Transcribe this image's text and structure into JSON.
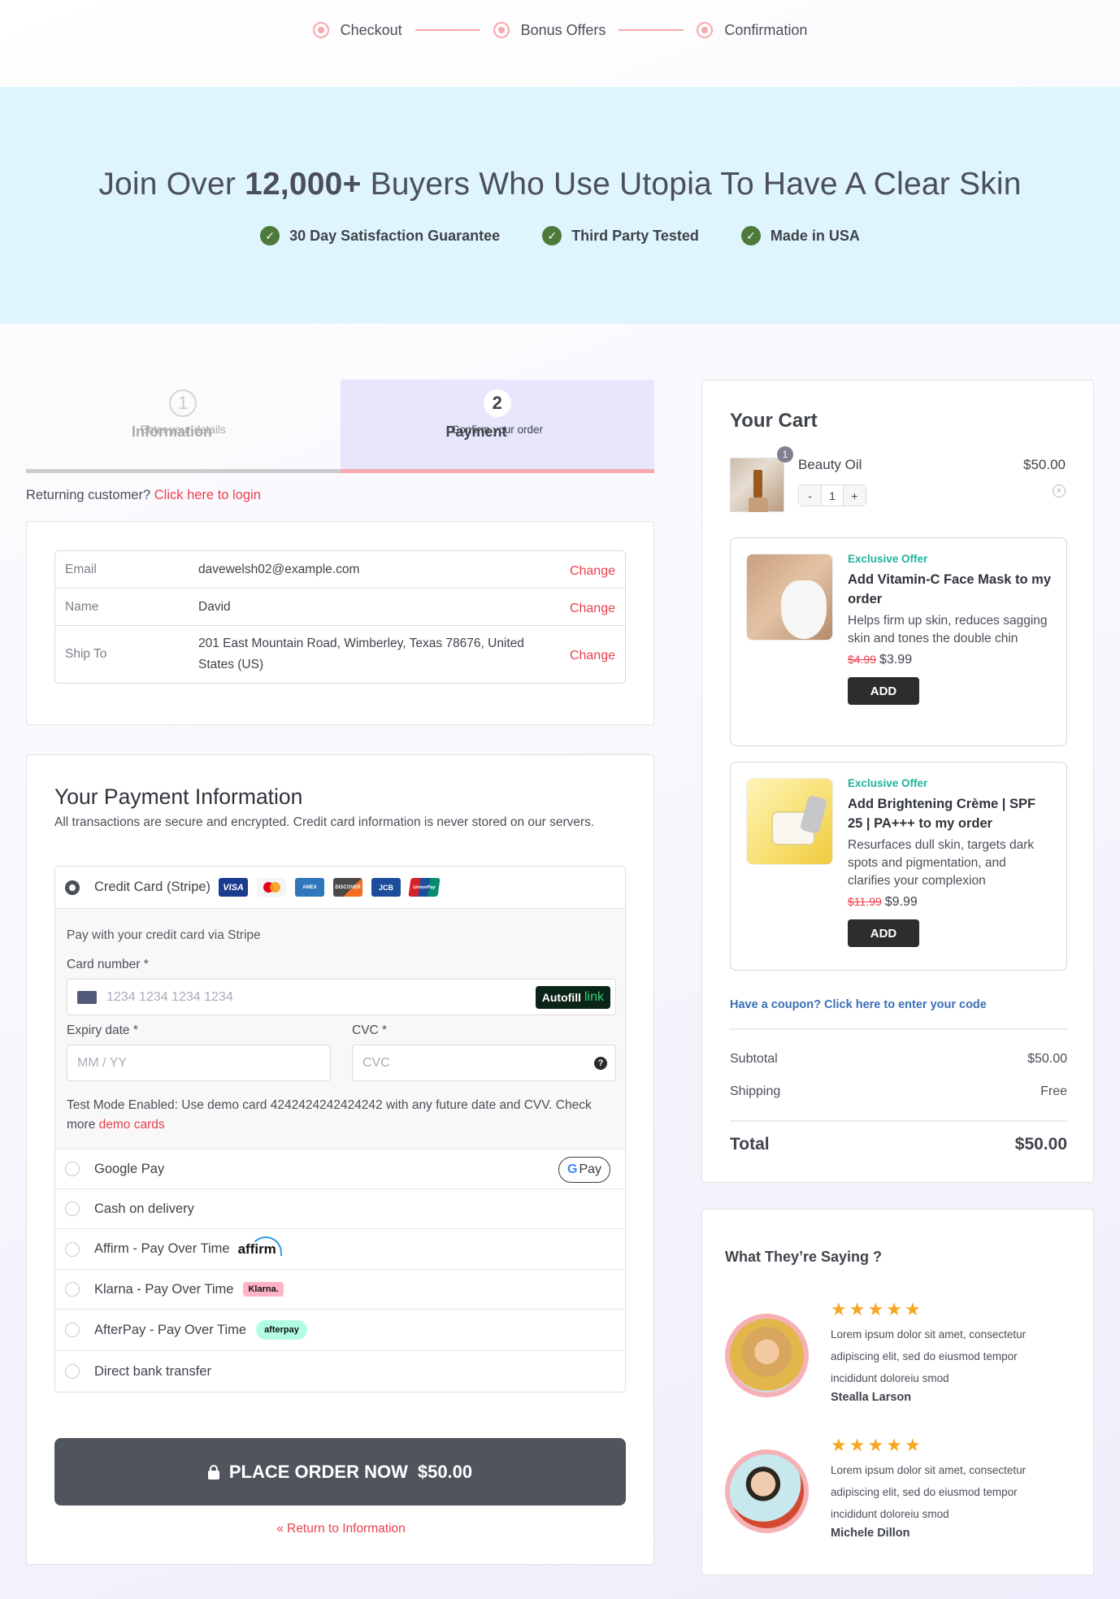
{
  "progress": {
    "steps": [
      "Checkout",
      "Bonus Offers",
      "Confirmation"
    ]
  },
  "hero": {
    "heading_pre": "Join Over ",
    "heading_bold": "12,000+",
    "heading_post": " Buyers Who Use Utopia To Have A Clear Skin",
    "badges": [
      "30 Day Satisfaction Guarantee",
      "Third Party Tested",
      "Made in USA"
    ]
  },
  "checkout_steps": [
    {
      "number": "1",
      "title": "Information",
      "subtitle": "Enter your details",
      "active": false
    },
    {
      "number": "2",
      "title": "Payment",
      "subtitle": "Confirm your order",
      "active": true
    }
  ],
  "returning": {
    "text": "Returning customer? ",
    "link": "Click here to login"
  },
  "info": {
    "change_label": "Change",
    "rows": [
      {
        "label": "Email",
        "value": "davewelsh02@example.com"
      },
      {
        "label": "Name",
        "value": "David"
      },
      {
        "label": "Ship To",
        "value": "201 East Mountain Road, Wimberley, Texas 78676, United States (US)"
      }
    ]
  },
  "payment": {
    "title": "Your Payment Information",
    "subtitle": "All transactions are secure and encrypted. Credit card information is never stored on our servers.",
    "credit_card": {
      "label": "Credit Card (Stripe)",
      "selected": true,
      "card_brands": [
        "VISA",
        "Mastercard",
        "American Express",
        "Discover",
        "JCB",
        "UnionPay"
      ],
      "description": "Pay with your credit card via Stripe",
      "card_number_label": "Card number *",
      "card_number_placeholder": "1234 1234 1234 1234",
      "autofill_label": "Autofill",
      "autofill_brand": "link",
      "expiry_label": "Expiry date *",
      "expiry_placeholder": "MM / YY",
      "cvc_label": "CVC *",
      "cvc_placeholder": "CVC",
      "test_mode_text": "Test Mode Enabled: Use demo card 4242424242424242 with any future date and CVV. Check more ",
      "test_mode_link": "demo cards"
    },
    "methods": [
      {
        "label": "Google Pay",
        "logo": "G Pay"
      },
      {
        "label": "Cash on delivery",
        "logo": ""
      },
      {
        "label": "Affirm - Pay Over Time",
        "logo": "affirm"
      },
      {
        "label": "Klarna - Pay Over Time",
        "logo": "Klarna."
      },
      {
        "label": "AfterPay - Pay Over Time",
        "logo": "afterpay"
      },
      {
        "label": "Direct bank transfer",
        "logo": ""
      }
    ],
    "place_order_label": "PLACE ORDER NOW",
    "place_order_amount": "$50.00",
    "return_link": "« Return to Information"
  },
  "cart": {
    "title": "Your Cart",
    "item": {
      "name": "Beauty Oil",
      "price": "$50.00",
      "quantity": "1",
      "badge": "1"
    },
    "offers": [
      {
        "tag": "Exclusive Offer",
        "title": "Add Vitamin-C Face Mask to my order",
        "description": "Helps firm up skin, reduces sagging skin and tones the double chin",
        "old_price": "$4.99",
        "price": "$3.99",
        "button": "ADD"
      },
      {
        "tag": "Exclusive Offer",
        "title": "Add Brightening Crème | SPF 25 | PA+++ to my order",
        "description": "Resurfaces dull skin, targets dark spots and pigmentation, and clarifies your complexion",
        "old_price": "$11.99",
        "price": "$9.99",
        "button": "ADD"
      }
    ],
    "coupon_link": "Have a coupon? Click here to enter your code",
    "subtotal_label": "Subtotal",
    "subtotal": "$50.00",
    "shipping_label": "Shipping",
    "shipping": "Free",
    "total_label": "Total",
    "total": "$50.00"
  },
  "testimonials": {
    "title": "What They’re Saying ?",
    "items": [
      {
        "rating": 5,
        "text": "Lorem ipsum dolor sit amet, consectetur adipiscing elit, sed do eiusmod tempor incididunt doloreiu smod",
        "name": "Stealla Larson"
      },
      {
        "rating": 5,
        "text": "Lorem ipsum dolor sit amet, consectetur adipiscing elit, sed do eiusmod tempor incididunt doloreiu smod",
        "name": "Michele Dillon"
      }
    ]
  },
  "colors": {
    "accent_pink": "#f7a9ae",
    "link_red": "#e8414d",
    "hero_bg": "#dff5fd",
    "check_green": "#4d7a3a",
    "offer_teal": "#1fb39a",
    "button_dark": "#50555d",
    "star": "#f5a623"
  }
}
